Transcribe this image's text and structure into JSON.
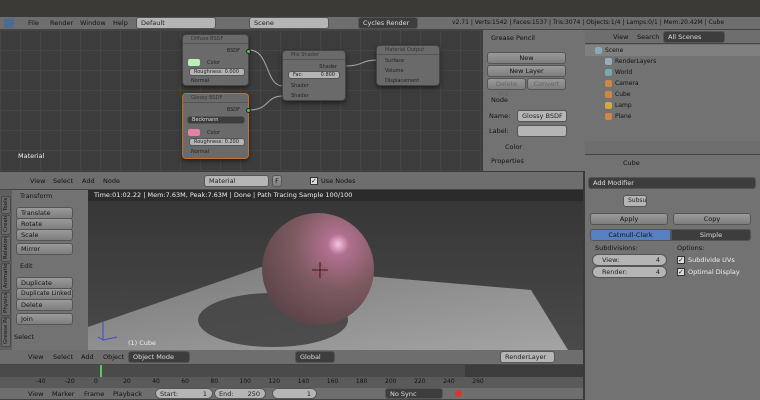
{
  "info_header": {
    "menus": [
      "File",
      "Render",
      "Window",
      "Help"
    ],
    "layout": "Default",
    "scene": "Scene",
    "engine": "Cycles Render",
    "stats": "v2.71 | Verts:1542 | Faces:1537 | Tris:3074 | Objects:1/4 | Lamps:0/1 | Mem:20.42M | Cube"
  },
  "node_editor": {
    "label": "Material",
    "nodes": {
      "diffuse": {
        "title": "Diffuse BSDF",
        "out": "BSDF",
        "color": "Color",
        "roughness_label": "Roughness:",
        "roughness": "0.000",
        "normal": "Normal",
        "swatch": "#b8f0b8"
      },
      "glossy": {
        "title": "Glossy BSDF",
        "out": "BSDF",
        "dist": "Beckmann",
        "color": "Color",
        "roughness_label": "Roughness:",
        "roughness": "0.200",
        "normal": "Normal",
        "swatch": "#e87fa6"
      },
      "mix": {
        "title": "Mix Shader",
        "out": "Shader",
        "fac_label": "Fac:",
        "fac": "0.800",
        "in1": "Shader",
        "in2": "Shader"
      },
      "output": {
        "title": "Material Output",
        "surface": "Surface",
        "volume": "Volume",
        "displacement": "Displacement"
      }
    },
    "header": {
      "menus": [
        "View",
        "Select",
        "Add",
        "Node"
      ],
      "material": "Material",
      "fake": "F",
      "use_nodes": "Use Nodes"
    }
  },
  "node_sidebar": {
    "grease_pencil": "Grease Pencil",
    "new": "New",
    "new_layer": "New Layer",
    "delete_frame": "Delete Fra...",
    "convert": "Convert",
    "node_section": "Node",
    "name_label": "Name:",
    "name": "Glossy BSDF",
    "label_label": "Label:",
    "label": "",
    "color": "Color",
    "properties": "Properties"
  },
  "outliner": {
    "menus": [
      "View",
      "Search"
    ],
    "filter": "All Scenes",
    "items": [
      "Scene",
      "RenderLayers",
      "World",
      "Camera",
      "Cube",
      "Lamp",
      "Plane"
    ]
  },
  "properties": {
    "breadcrumb": "Cube",
    "add_modifier": "Add Modifier",
    "mod_name": "Subsu",
    "apply": "Apply",
    "copy": "Copy",
    "tabs": [
      "Catmull-Clark",
      "Simple"
    ],
    "subdivisions": "Subdivisions:",
    "view_label": "View:",
    "view": "4",
    "render_label": "Render:",
    "render": "4",
    "options": "Options:",
    "subdivide_uvs": "Subdivide UVs",
    "optimal_display": "Optimal Display"
  },
  "toolshelf": {
    "tabs": [
      "Tools",
      "Create",
      "Relations",
      "Animation",
      "Physics",
      "Grease Pencil"
    ],
    "transform": "Transform",
    "transform_btns": [
      "Translate",
      "Rotate",
      "Scale"
    ],
    "mirror": "Mirror",
    "edit": "Edit",
    "edit_btns": [
      "Duplicate",
      "Duplicate Linked",
      "Delete"
    ],
    "join": "Join",
    "select": "Select"
  },
  "viewport": {
    "render_info": "Time:01:02.22 | Mem:7.63M, Peak:7.63M | Done | Path Tracing Sample 100/100",
    "object_label": "(1) Cube",
    "header": {
      "menus": [
        "View",
        "Select",
        "Add",
        "Object"
      ],
      "mode": "Object Mode",
      "orientation": "Global",
      "render_layer": "RenderLayer"
    }
  },
  "timeline": {
    "ticks": [
      "-40",
      "-20",
      "0",
      "20",
      "40",
      "60",
      "80",
      "100",
      "120",
      "140",
      "160",
      "180",
      "200",
      "220",
      "240",
      "260"
    ],
    "current_frame": "1",
    "menus": [
      "View",
      "Marker",
      "Frame",
      "Playback"
    ],
    "start_label": "Start:",
    "start": "1",
    "end_label": "End:",
    "end": "250",
    "sync": "No Sync"
  }
}
